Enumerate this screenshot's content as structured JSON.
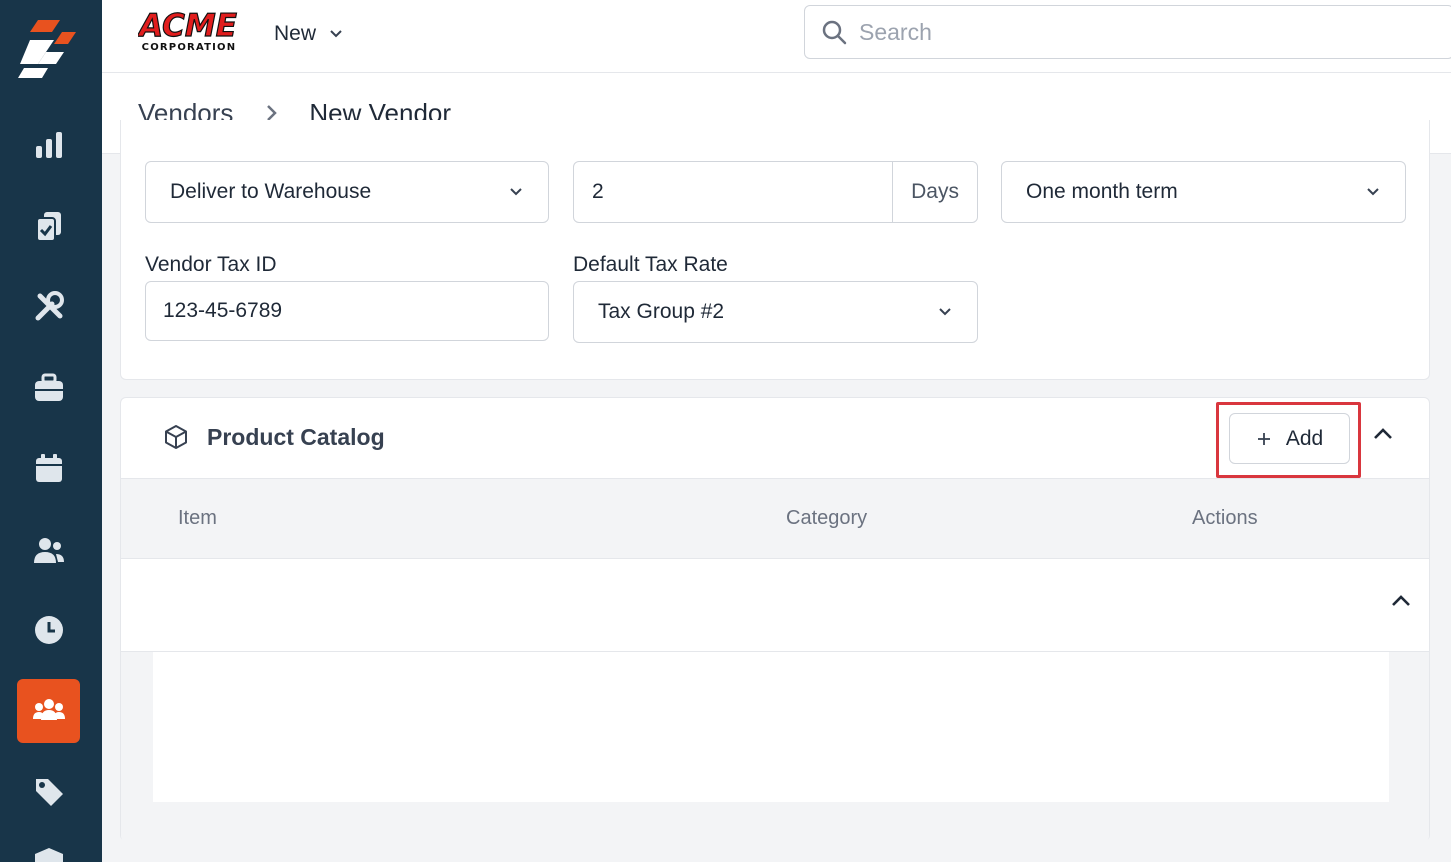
{
  "topbar": {
    "brand": {
      "word": "ACME",
      "sub": "CORPORATION"
    },
    "new_menu_label": "New",
    "search_placeholder": "Search"
  },
  "sidebar": {
    "items": [
      {
        "name": "reports",
        "icon": "bar-chart-icon",
        "active": false
      },
      {
        "name": "tasks",
        "icon": "clipboard-check-icon",
        "active": false
      },
      {
        "name": "services",
        "icon": "tools-icon",
        "active": false
      },
      {
        "name": "jobs",
        "icon": "briefcase-icon",
        "active": false
      },
      {
        "name": "calendar",
        "icon": "calendar-icon",
        "active": false
      },
      {
        "name": "customers",
        "icon": "users-icon",
        "active": false
      },
      {
        "name": "time",
        "icon": "clock-icon",
        "active": false
      },
      {
        "name": "vendors",
        "icon": "group-icon",
        "active": true
      },
      {
        "name": "pricing",
        "icon": "tag-icon",
        "active": false
      }
    ],
    "active_color": "#e8521f",
    "bg_color": "#183549"
  },
  "breadcrumb": {
    "parent": "Vendors",
    "current": "New Vendor"
  },
  "form": {
    "shipping_method": "Deliver to Warehouse",
    "lead_time_value": "2",
    "lead_time_unit": "Days",
    "payment_terms": "One month term",
    "vendor_tax_id_label": "Vendor Tax ID",
    "vendor_tax_id_value": "123-45-6789",
    "default_tax_rate_label": "Default Tax Rate",
    "default_tax_rate_value": "Tax Group #2"
  },
  "product_catalog": {
    "title": "Product Catalog",
    "add_label": "Add",
    "columns": [
      "Item",
      "Category",
      "Actions"
    ],
    "rows": []
  },
  "colors": {
    "highlight": "#d9363e"
  }
}
